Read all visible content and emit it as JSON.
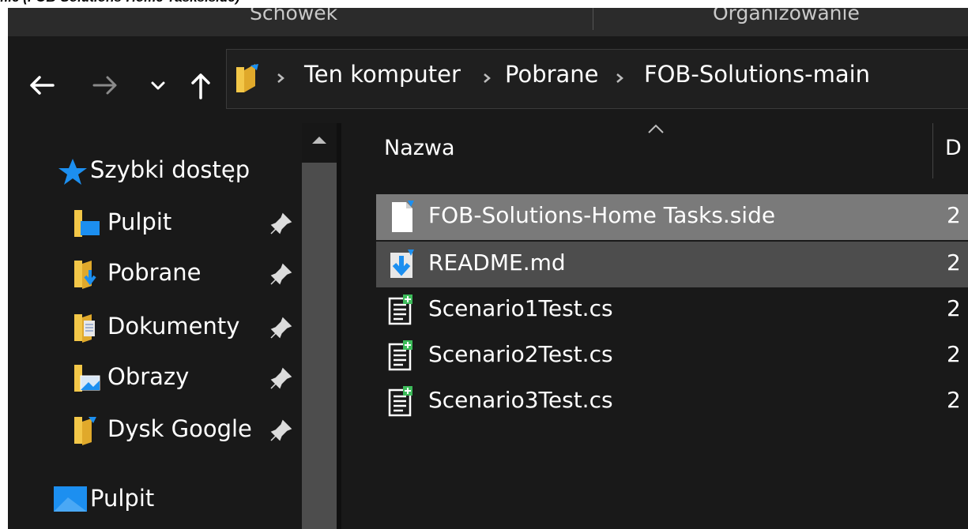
{
  "top_caption": "file (FOB-Solutions-Home Tasks.side)",
  "ribbon": {
    "groups": [
      "Schowek",
      "Organizowanie"
    ]
  },
  "nav": {
    "back": "←",
    "forward": "→",
    "recent": "⌄",
    "up": "↑"
  },
  "address": {
    "crumbs": [
      "Ten komputer",
      "Pobrane",
      "FOB-Solutions-main"
    ]
  },
  "sidebar": {
    "quick_access": "Szybki dostęp",
    "items": [
      {
        "label": "Pulpit",
        "icon": "desktop-folder-icon",
        "pinned": true
      },
      {
        "label": "Pobrane",
        "icon": "downloads-folder-icon",
        "pinned": true
      },
      {
        "label": "Dokumenty",
        "icon": "documents-folder-icon",
        "pinned": true
      },
      {
        "label": "Obrazy",
        "icon": "pictures-folder-icon",
        "pinned": true
      },
      {
        "label": "Dysk Google",
        "icon": "google-drive-folder-icon",
        "pinned": true
      }
    ],
    "desktop": "Pulpit"
  },
  "filelist": {
    "col_name": "Nazwa",
    "col_date": "D",
    "rows": [
      {
        "name": "FOB-Solutions-Home Tasks.side",
        "date": "2",
        "state": "selected",
        "icon": "blank-file-icon"
      },
      {
        "name": "README.md",
        "date": "2",
        "state": "hover",
        "icon": "download-file-icon"
      },
      {
        "name": "Scenario1Test.cs",
        "date": "2",
        "state": "normal",
        "icon": "csharp-file-icon"
      },
      {
        "name": "Scenario2Test.cs",
        "date": "2",
        "state": "normal",
        "icon": "csharp-file-icon"
      },
      {
        "name": "Scenario3Test.cs",
        "date": "2",
        "state": "normal",
        "icon": "csharp-file-icon"
      }
    ]
  },
  "colors": {
    "background": "#191919",
    "selected_row": "#7a7a7a",
    "hover_row": "#4d4d4d",
    "folder_yellow": "#f3c748",
    "accent_blue": "#1c8ff0"
  }
}
